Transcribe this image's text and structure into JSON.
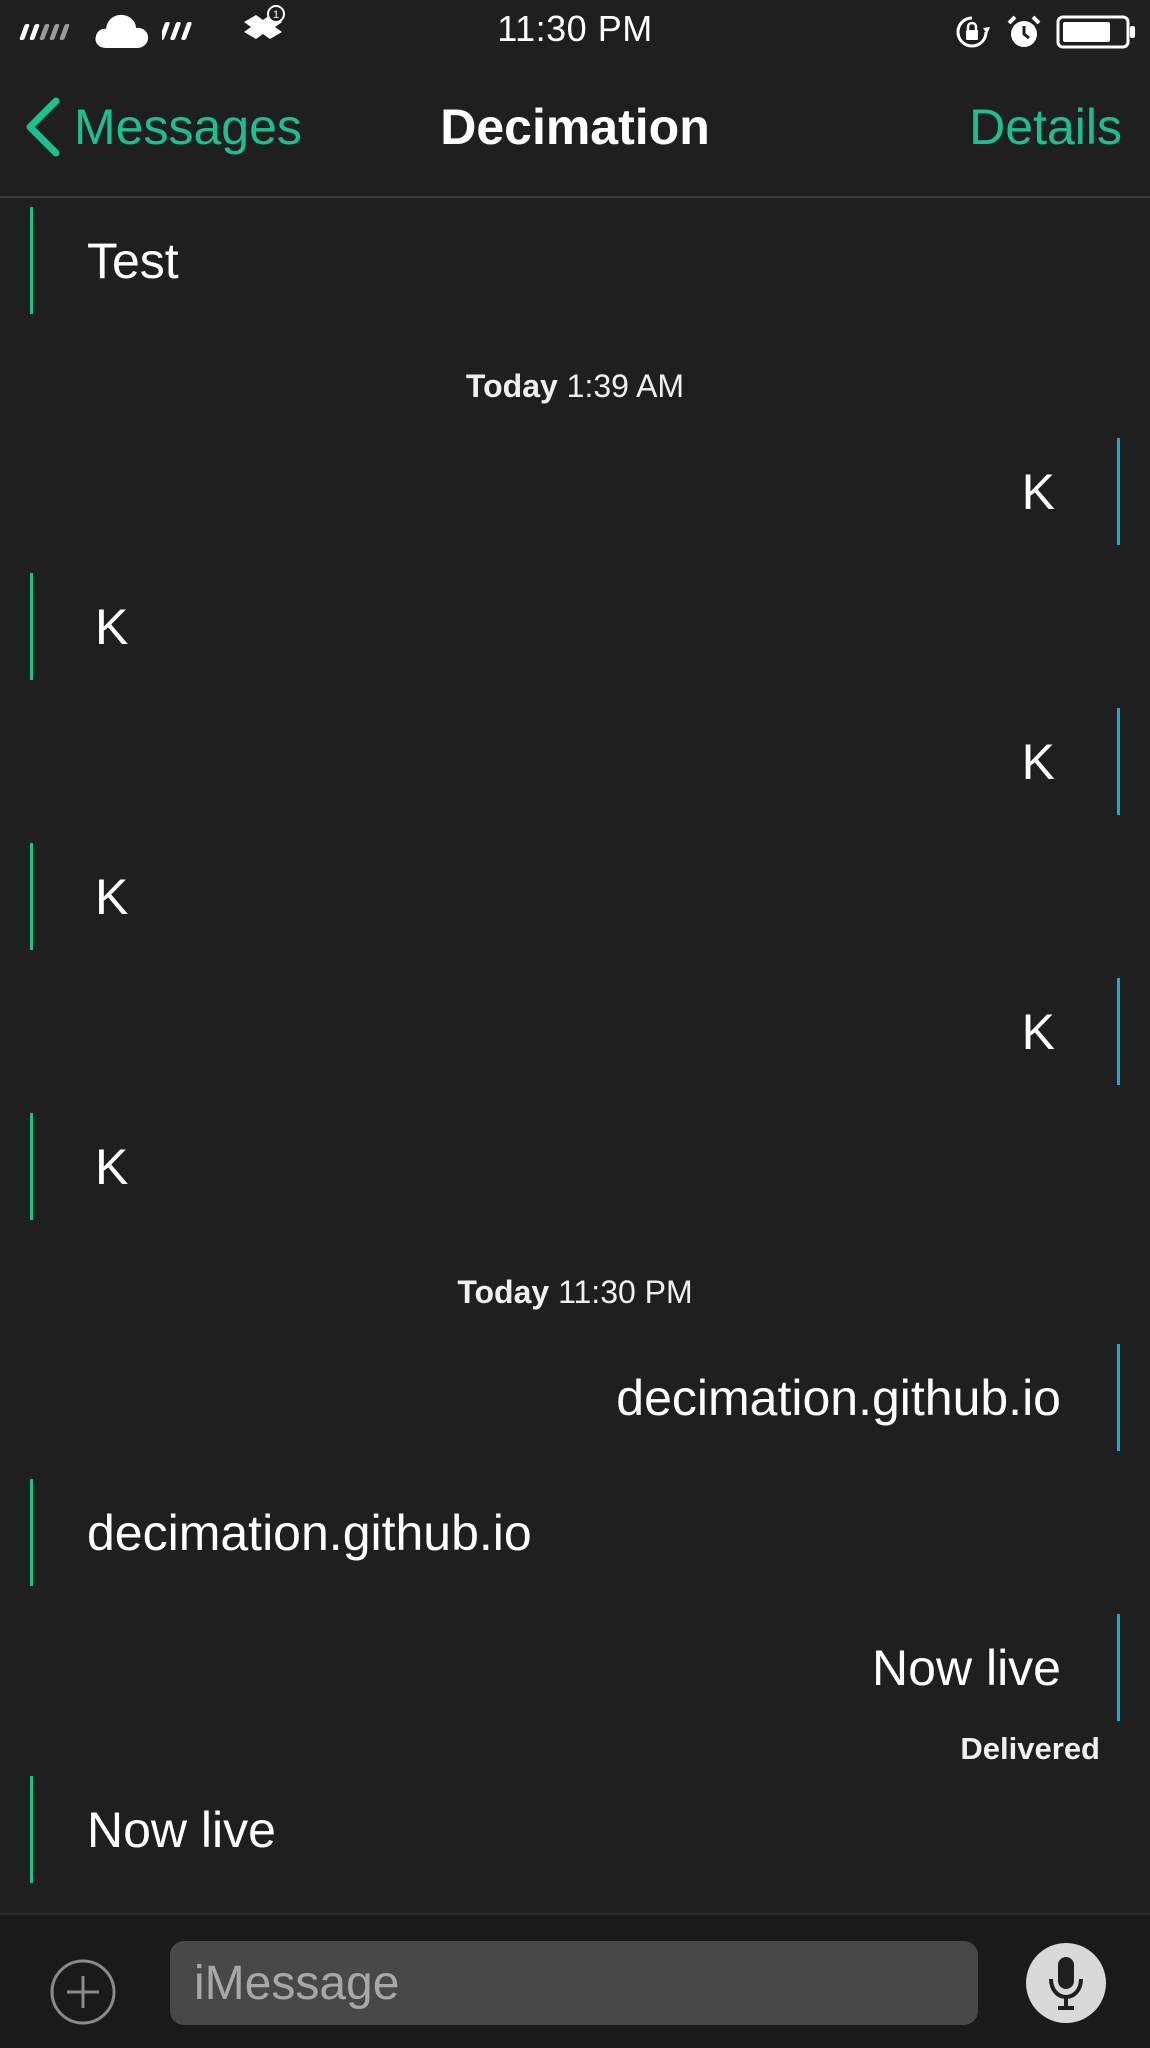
{
  "status_bar": {
    "time": "11:30 PM",
    "icons": [
      "signal-dots-icon",
      "cloud-icon",
      "wifi-dash-icon",
      "dropbox-icon",
      "rotation-lock-icon",
      "alarm-icon",
      "battery-icon"
    ],
    "notification_count": "1"
  },
  "nav": {
    "back_label": "Messages",
    "title": "Decimation",
    "details_label": "Details",
    "accent_color": "#1bc091"
  },
  "colors": {
    "background": "#1f1f1f",
    "incoming_bar": "#1bc091",
    "outgoing_bar": "#1ba8d5"
  },
  "conversation": {
    "messages": [
      {
        "direction": "incoming",
        "text": "Test"
      },
      {
        "direction": "outgoing",
        "text": "K"
      },
      {
        "direction": "incoming",
        "text": "K"
      },
      {
        "direction": "outgoing",
        "text": "K"
      },
      {
        "direction": "incoming",
        "text": "K"
      },
      {
        "direction": "outgoing",
        "text": "K"
      },
      {
        "direction": "incoming",
        "text": "K"
      },
      {
        "direction": "outgoing",
        "text": "decimation.github.io"
      },
      {
        "direction": "incoming",
        "text": "decimation.github.io"
      },
      {
        "direction": "outgoing",
        "text": "Now live"
      },
      {
        "direction": "incoming",
        "text": "Now live"
      }
    ],
    "timestamps": [
      {
        "day": "Today",
        "time": "1:39 AM"
      },
      {
        "day": "Today",
        "time": "11:30 PM"
      }
    ],
    "delivered_label": "Delivered"
  },
  "input": {
    "placeholder": "iMessage"
  }
}
